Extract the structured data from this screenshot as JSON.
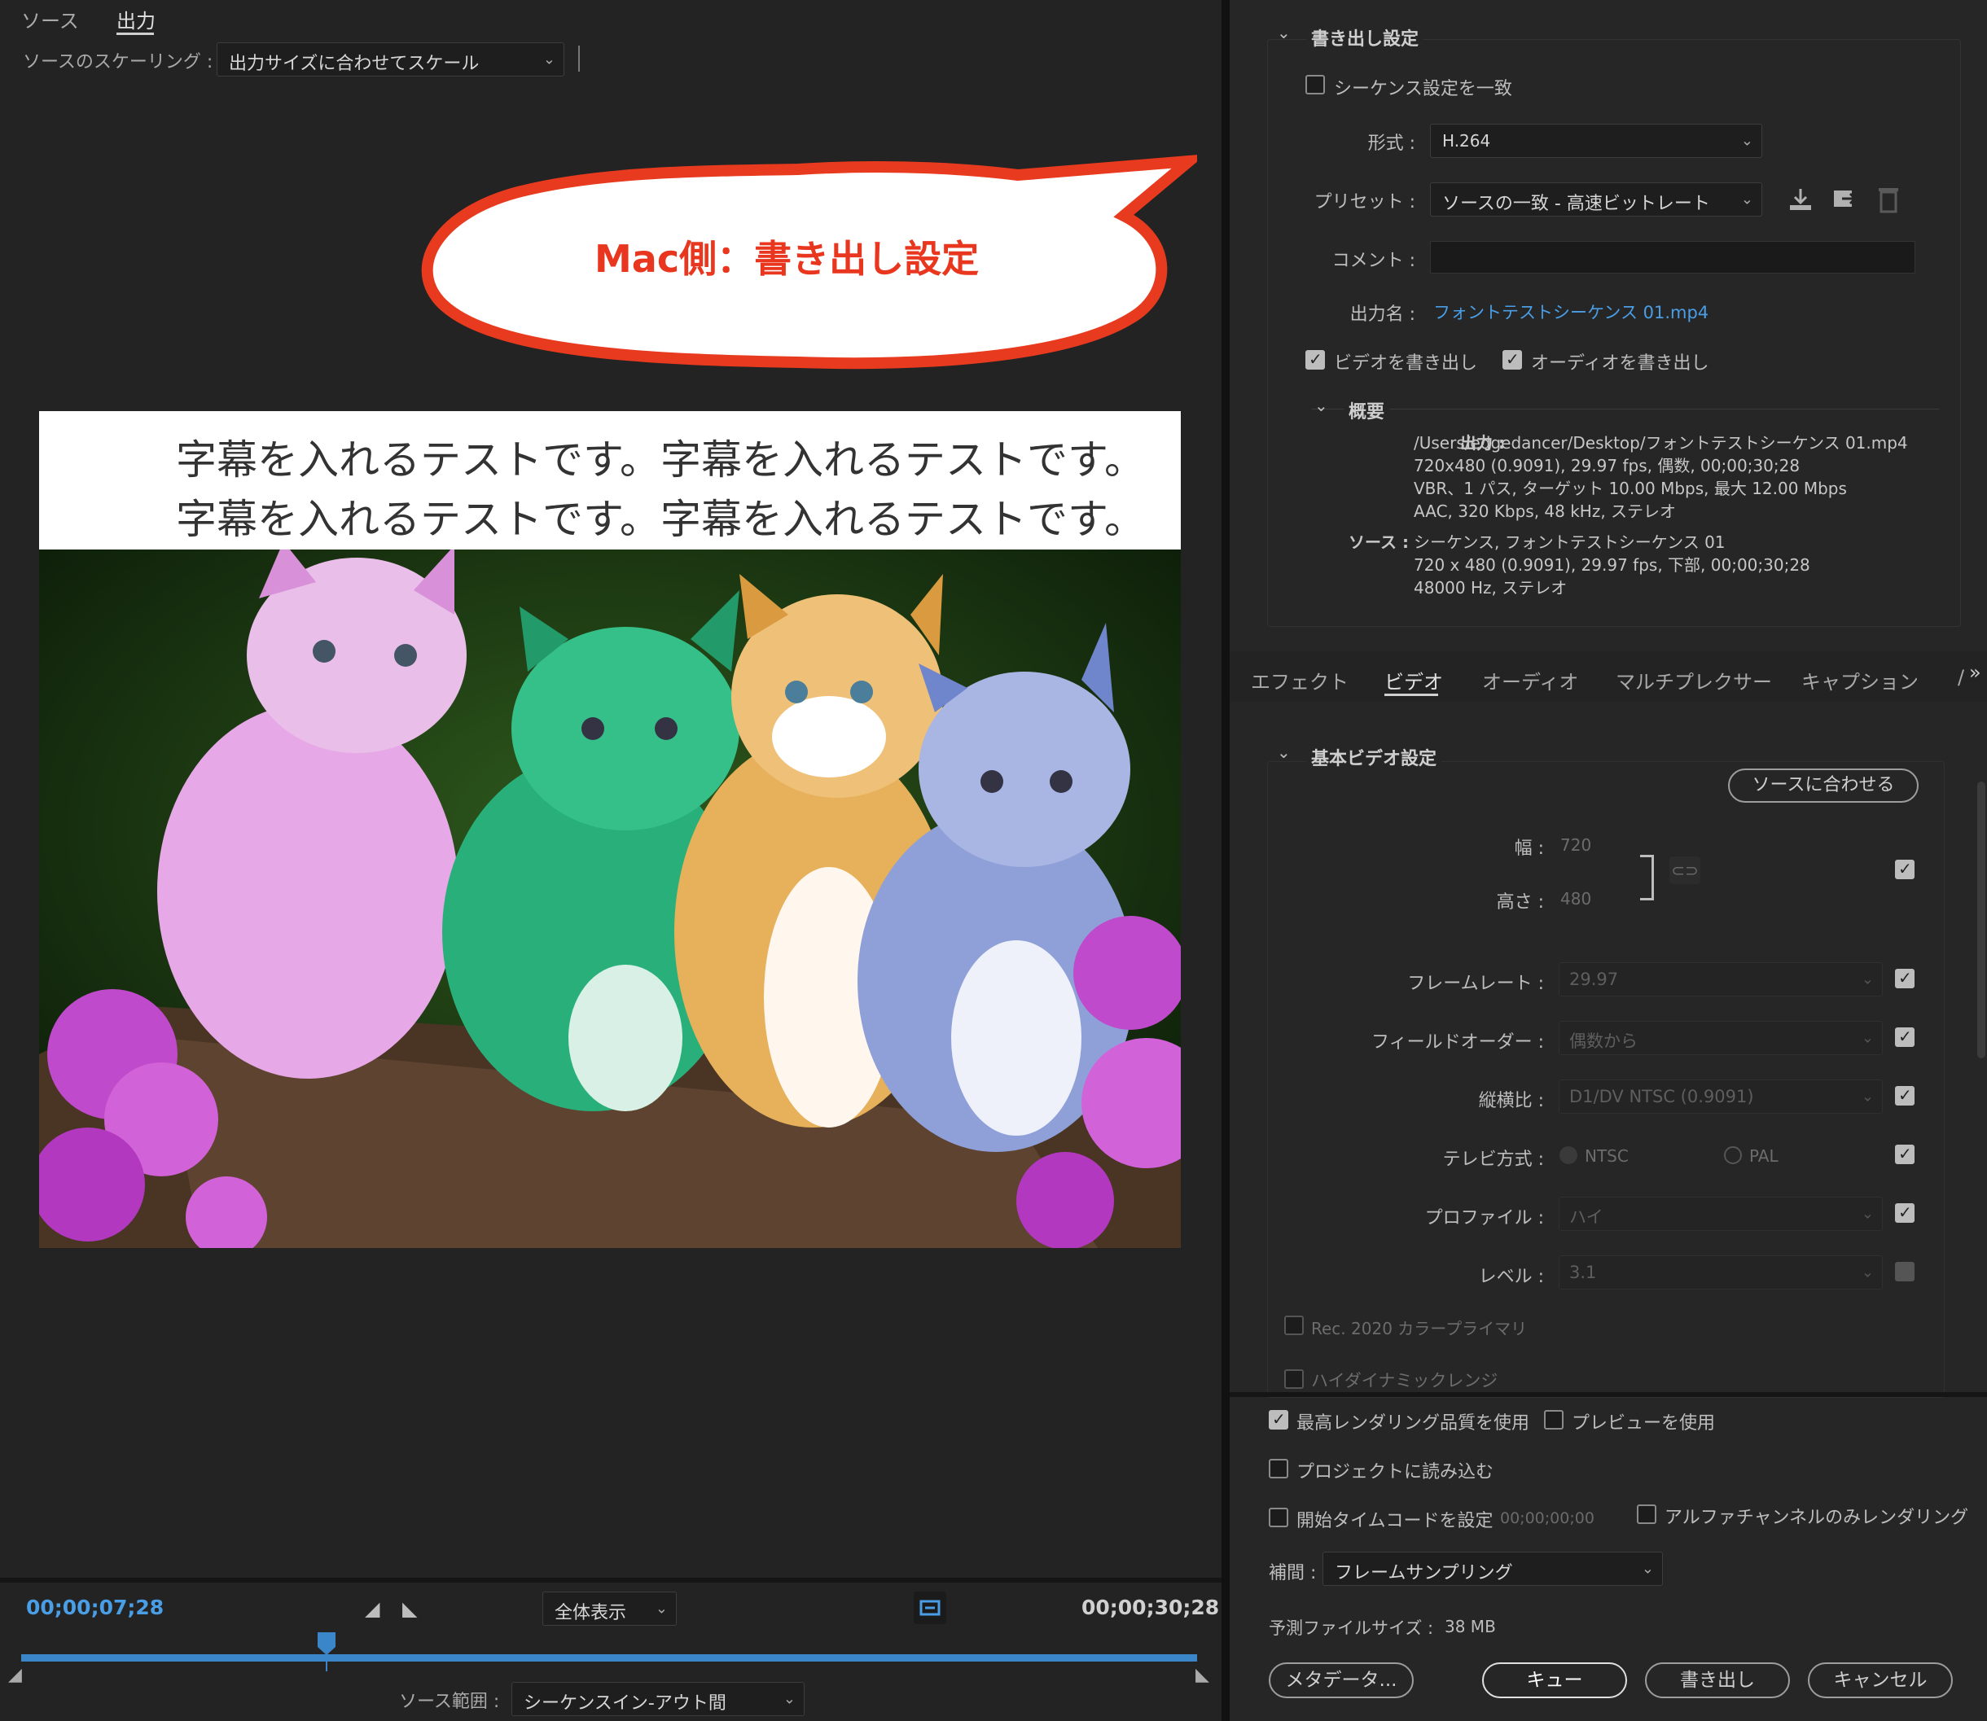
{
  "left": {
    "tabs": [
      "ソース",
      "出力"
    ],
    "scaling_label": "ソースのスケーリング :",
    "scaling_value": "出力サイズに合わせてスケール",
    "callout": "Mac側：書き出し設定",
    "subtitle_lines": [
      "字幕を入れるテストです。字幕を入れるテストです。",
      "字幕を入れるテストです。字幕を入れるテストです。"
    ],
    "timecode_current": "00;00;07;28",
    "timecode_end": "00;00;30;28",
    "zoom_value": "全体表示",
    "source_range_label": "ソース範囲 :",
    "source_range_value": "シーケンスイン-アウト間",
    "playhead_fraction": 0.26
  },
  "export": {
    "title": "書き出し設定",
    "match_sequence": "シーケンス設定を一致",
    "format_label": "形式 :",
    "format_value": "H.264",
    "preset_label": "プリセット :",
    "preset_value": "ソースの一致 - 高速ビットレート",
    "comment_label": "コメント :",
    "output_name_label": "出力名 :",
    "output_name_value": "フォントテストシーケンス 01.mp4",
    "export_video": "ビデオを書き出し",
    "export_audio": "オーディオを書き出し",
    "summary_title": "概要",
    "summary_output_label": "出力 :",
    "summary_output_lines": [
      "/Users/edgedancer/Desktop/フォントテストシーケンス 01.mp4",
      "720x480 (0.9091), 29.97 fps, 偶数, 00;00;30;28",
      "VBR、1 パス, ターゲット 10.00 Mbps, 最大 12.00 Mbps",
      "AAC, 320 Kbps, 48 kHz, ステレオ"
    ],
    "summary_source_label": "ソース :",
    "summary_source_lines": [
      "シーケンス, フォントテストシーケンス 01",
      "720 x 480 (0.9091), 29.97 fps, 下部, 00;00;30;28",
      "48000 Hz, ステレオ"
    ]
  },
  "tabs": [
    "エフェクト",
    "ビデオ",
    "オーディオ",
    "マルチプレクサー",
    "キャプション",
    "/"
  ],
  "video": {
    "title": "基本ビデオ設定",
    "match_source_btn": "ソースに合わせる",
    "width_label": "幅 :",
    "width_value": "720",
    "height_label": "高さ :",
    "height_value": "480",
    "framerate_label": "フレームレート :",
    "framerate_value": "29.97",
    "field_label": "フィールドオーダー :",
    "field_value": "偶数から",
    "aspect_label": "縦横比 :",
    "aspect_value": "D1/DV NTSC (0.9091)",
    "tv_label": "テレビ方式 :",
    "tv_ntsc": "NTSC",
    "tv_pal": "PAL",
    "profile_label": "プロファイル :",
    "profile_value": "ハイ",
    "level_label": "レベル :",
    "level_value": "3.1",
    "rec2020": "Rec. 2020 カラープライマリ",
    "hdr": "ハイダイナミックレンジ"
  },
  "bottom": {
    "max_quality": "最高レンダリング品質を使用",
    "use_preview": "プレビューを使用",
    "import_project": "プロジェクトに読み込む",
    "set_start_tc": "開始タイムコードを設定",
    "start_tc_value": "00;00;00;00",
    "alpha_only": "アルファチャンネルのみレンダリング",
    "interp_label": "補間 :",
    "interp_value": "フレームサンプリング",
    "filesize_label": "予測ファイルサイズ :",
    "filesize_value": "38 MB",
    "btn_metadata": "メタデータ...",
    "btn_queue": "キュー",
    "btn_export": "書き出し",
    "btn_cancel": "キャンセル"
  },
  "colors": {
    "accent": "#4a9ee6",
    "callout_red": "#e83a1f",
    "callout_text": "#e8361f"
  }
}
